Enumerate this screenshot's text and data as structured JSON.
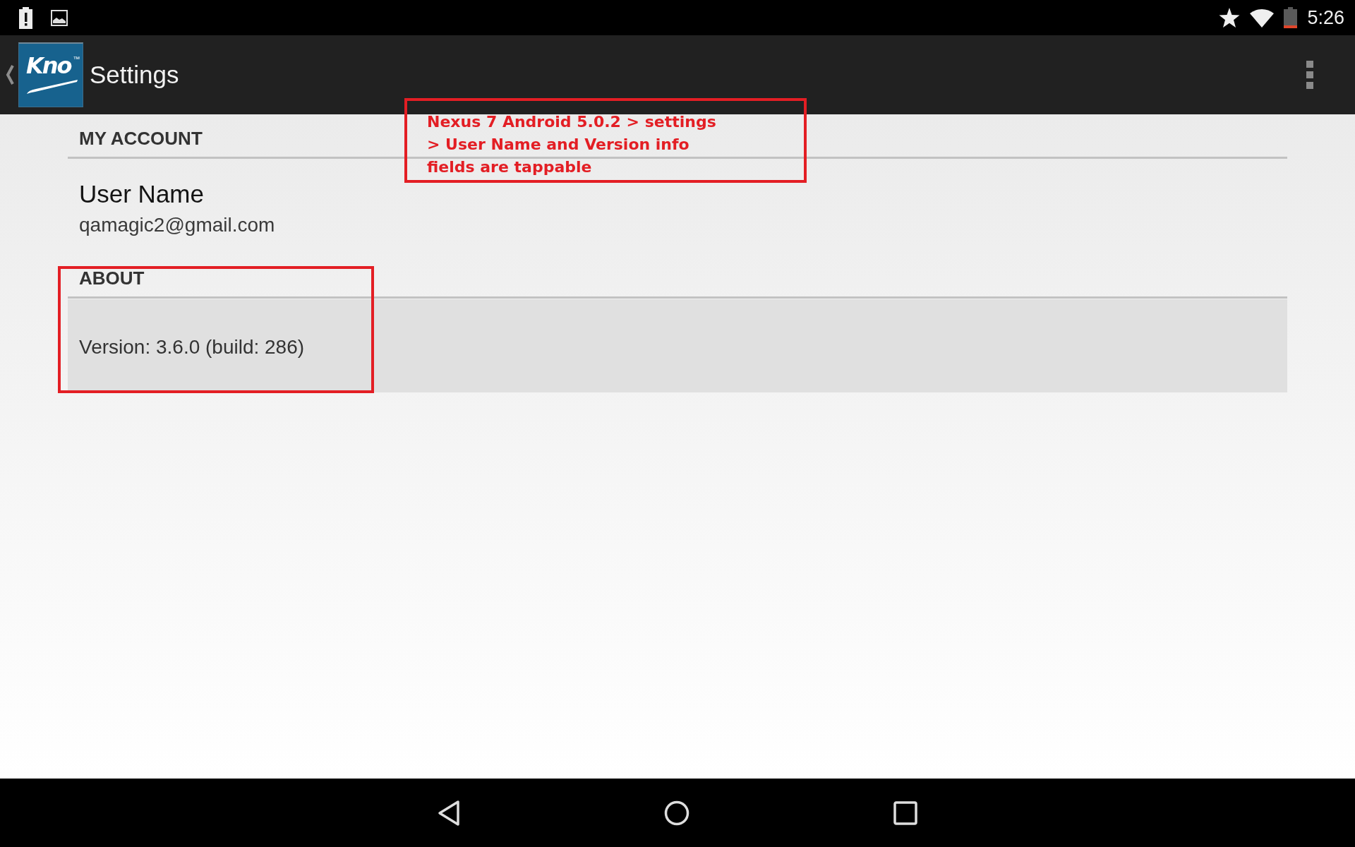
{
  "status_bar": {
    "time": "5:26"
  },
  "app_bar": {
    "logo": {
      "text": "Kno",
      "trademark": "™"
    },
    "title": "Settings"
  },
  "sections": [
    {
      "header": "MY ACCOUNT",
      "items": [
        {
          "kind": "two_line",
          "title": "User Name",
          "summary": "qamagic2@gmail.com",
          "selected": false
        }
      ]
    },
    {
      "header": "ABOUT",
      "items": [
        {
          "kind": "one_line",
          "text": "Version: 3.6.0 (build: 286)",
          "selected": true
        }
      ]
    }
  ],
  "annotations": [
    {
      "kind": "callout",
      "text": "Nexus 7 Android 5.0.2 > settings\n> User Name and Version info\nfields are tappable"
    },
    {
      "kind": "frame"
    }
  ]
}
